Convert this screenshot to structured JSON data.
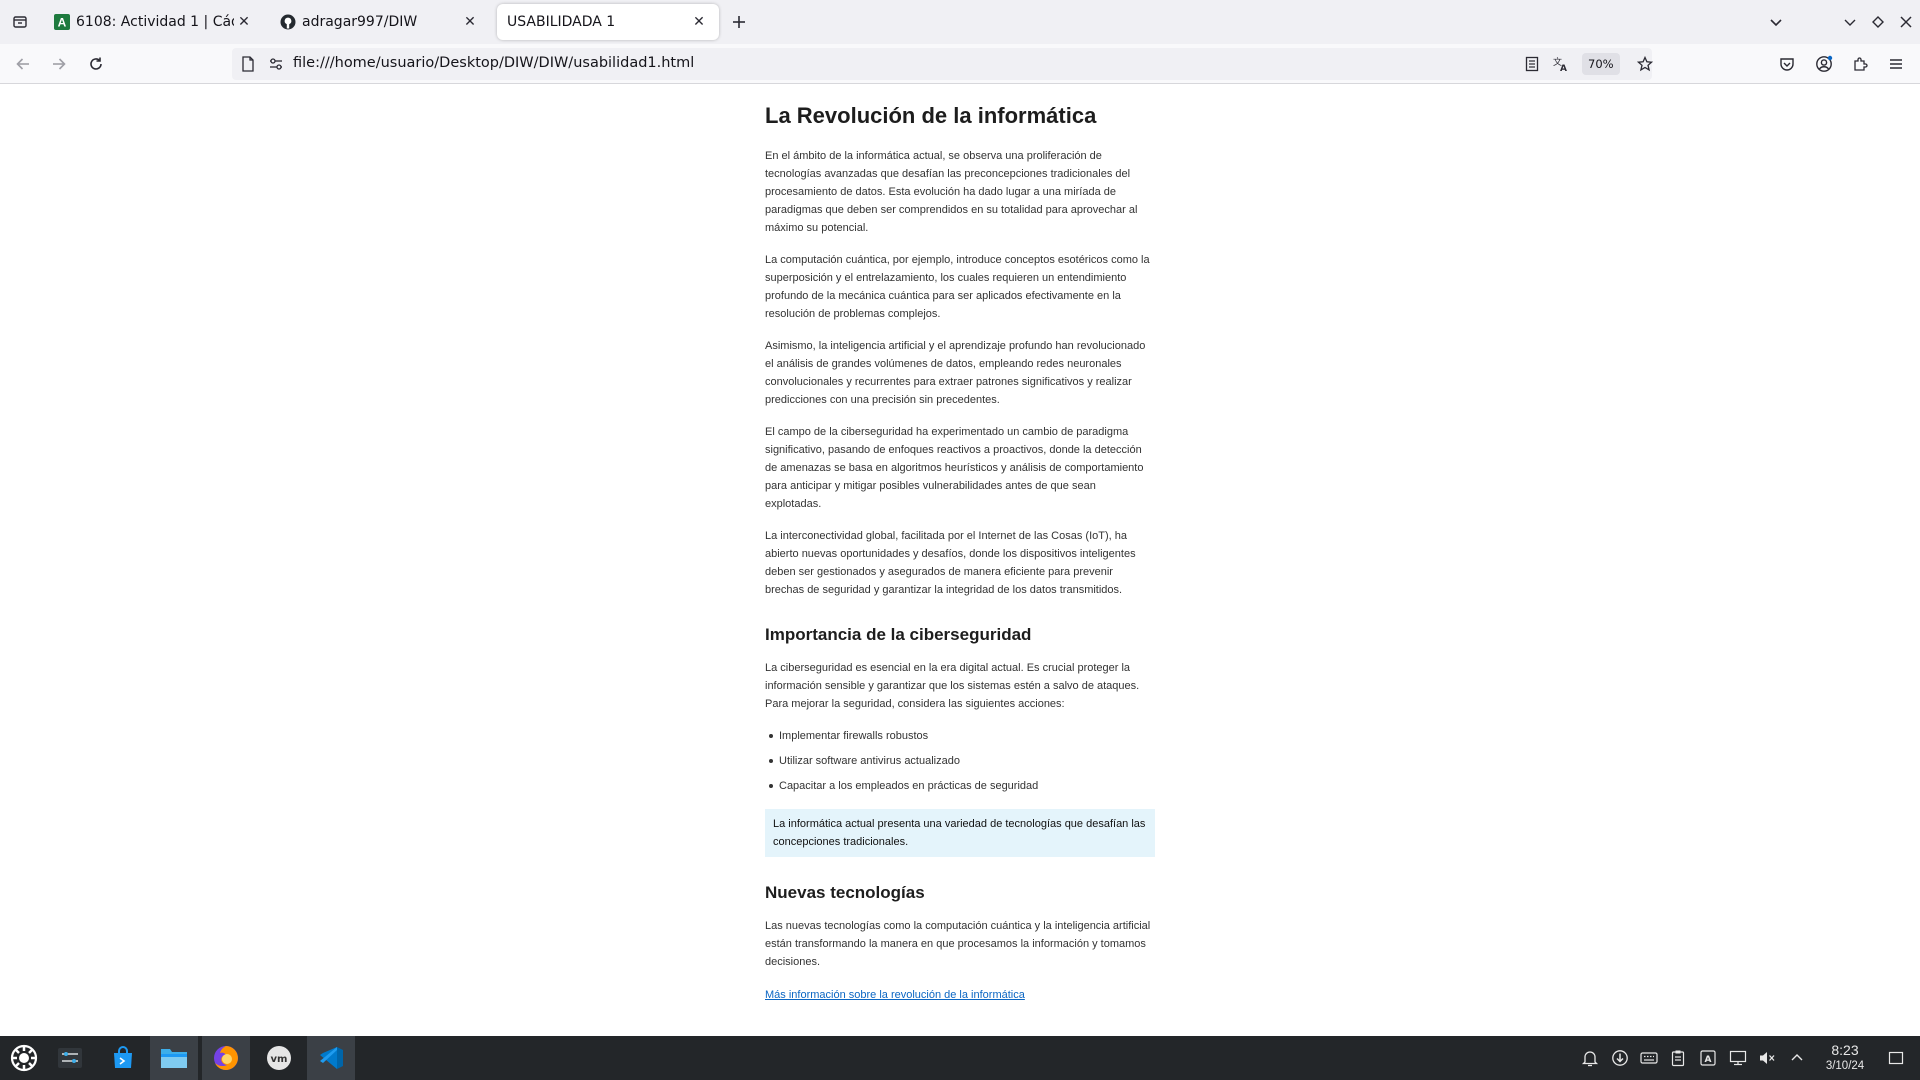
{
  "browser": {
    "tabs": [
      {
        "title": "6108: Actividad 1 | Cádiz",
        "active": false
      },
      {
        "title": "adragar997/DIW",
        "active": false
      },
      {
        "title": "USABILIDADA 1",
        "active": true
      }
    ],
    "url": "file:///home/usuario/Desktop/DIW/DIW/usabilidad1.html",
    "zoom": "70%"
  },
  "page": {
    "title": "La Revolución de la informática",
    "paragraphs": [
      "En el ámbito de la informática actual, se observa una proliferación de tecnologías avanzadas que desafían las preconcepciones tradicionales del procesamiento de datos. Esta evolución ha dado lugar a una miríada de paradigmas que deben ser comprendidos en su totalidad para aprovechar al máximo su potencial.",
      "La computación cuántica, por ejemplo, introduce conceptos esotéricos como la superposición y el entrelazamiento, los cuales requieren un entendimiento profundo de la mecánica cuántica para ser aplicados efectivamente en la resolución de problemas complejos.",
      "Asimismo, la inteligencia artificial y el aprendizaje profundo han revolucionado el análisis de grandes volúmenes de datos, empleando redes neuronales convolucionales y recurrentes para extraer patrones significativos y realizar predicciones con una precisión sin precedentes.",
      "El campo de la ciberseguridad ha experimentado un cambio de paradigma significativo, pasando de enfoques reactivos a proactivos, donde la detección de amenazas se basa en algoritmos heurísticos y análisis de comportamiento para anticipar y mitigar posibles vulnerabilidades antes de que sean explotadas.",
      "La interconectividad global, facilitada por el Internet de las Cosas (IoT), ha abierto nuevas oportunidades y desafíos, donde los dispositivos inteligentes deben ser gestionados y asegurados de manera eficiente para prevenir brechas de seguridad y garantizar la integridad de los datos transmitidos."
    ],
    "security": {
      "heading": "Importancia de la ciberseguridad",
      "intro": "La ciberseguridad es esencial en la era digital actual. Es crucial proteger la información sensible y garantizar que los sistemas estén a salvo de ataques. Para mejorar la seguridad, considera las siguientes acciones:",
      "items": [
        "Implementar firewalls robustos",
        "Utilizar software antivirus actualizado",
        "Capacitar a los empleados en prácticas de seguridad"
      ],
      "callout": "La informática actual presenta una variedad de tecnologías que desafían las concepciones tradicionales."
    },
    "newtech": {
      "heading": "Nuevas tecnologías",
      "text": "Las nuevas tecnologías como la computación cuántica y la inteligencia artificial están transformando la manera en que procesamos la información y tomamos decisiones.",
      "link": "Más información sobre la revolución de la informática"
    }
  },
  "taskbar": {
    "time": "8:23",
    "date": "3/10/24"
  },
  "colors": {
    "accent": "#0b66c3",
    "callout_bg": "#e4f4fb",
    "taskbar_bg": "#232629"
  }
}
